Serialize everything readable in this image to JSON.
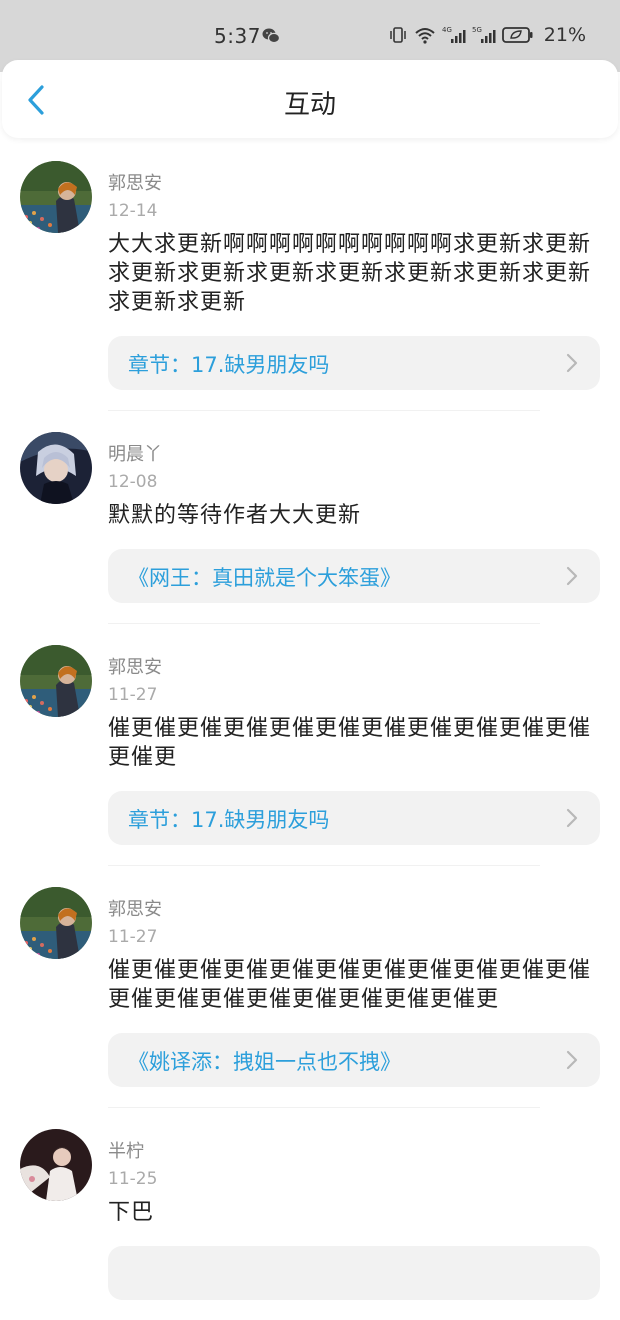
{
  "status_bar": {
    "time": "5:37",
    "battery": "21%"
  },
  "header": {
    "title": "互动",
    "accent_color": "#2c9fdb"
  },
  "comments": [
    {
      "username": "郭思安",
      "date": "12-14",
      "content": "大大求更新啊啊啊啊啊啊啊啊啊啊求更新求更新求更新求更新求更新求更新求更新求更新求更新求更新求更新",
      "link": "章节：17.缺男朋友吗"
    },
    {
      "username": "明晨丫",
      "date": "12-08",
      "content": "默默的等待作者大大更新",
      "link": "《网王：真田就是个大笨蛋》"
    },
    {
      "username": "郭思安",
      "date": "11-27",
      "content": "催更催更催更催更催更催更催更催更催更催更催更催更",
      "link": "章节：17.缺男朋友吗"
    },
    {
      "username": "郭思安",
      "date": "11-27",
      "content": "催更催更催更催更催更催更催更催更催更催更催更催更催更催更催更催更催更催更催更",
      "link": "《姚译添：拽姐一点也不拽》"
    },
    {
      "username": "半柠",
      "date": "11-25",
      "content": "下巴",
      "link": ""
    }
  ]
}
